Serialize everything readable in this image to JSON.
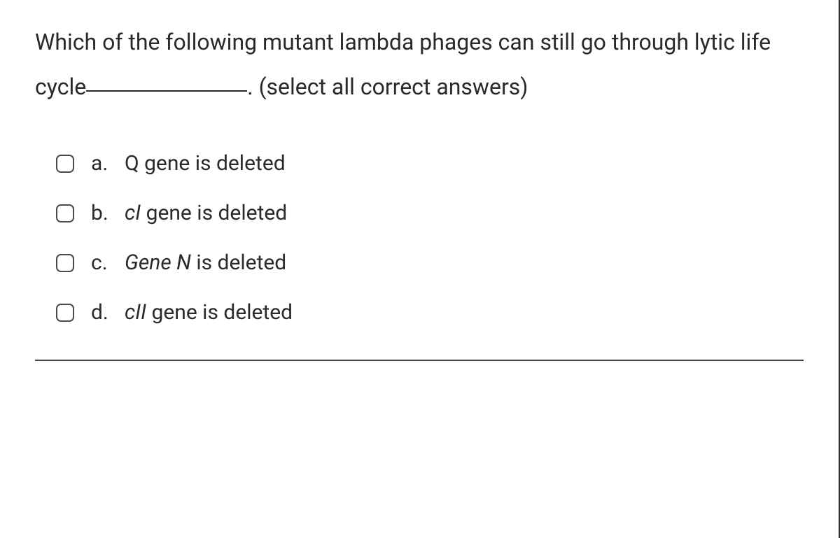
{
  "question": {
    "part1": "Which of the following mutant lambda phages can still go through lytic life cycle",
    "part2": ". (select all correct answers)"
  },
  "options": [
    {
      "letter": "a.",
      "text": "Q gene is deleted",
      "italic_prefix": ""
    },
    {
      "letter": "b.",
      "text": " gene is deleted",
      "italic_prefix": "cI"
    },
    {
      "letter": "c.",
      "text": " is deleted",
      "italic_prefix": "Gene N"
    },
    {
      "letter": "d.",
      "text": " gene is deleted",
      "italic_prefix": "cII"
    }
  ]
}
